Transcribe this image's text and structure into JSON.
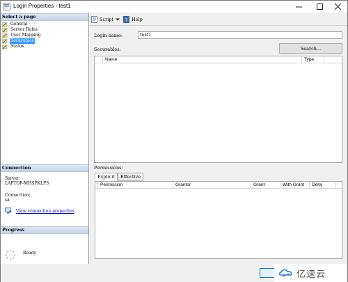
{
  "window": {
    "title": "Login Properties - test1"
  },
  "sidebar": {
    "select_page_header": "Select a page",
    "items": [
      {
        "label": "General",
        "selected": false
      },
      {
        "label": "Server Roles",
        "selected": false
      },
      {
        "label": "User Mapping",
        "selected": false
      },
      {
        "label": "Securables",
        "selected": true
      },
      {
        "label": "Status",
        "selected": false
      }
    ],
    "connection_header": "Connection",
    "server_label": "Server:",
    "server_value": "LAPTOP-MHSPKLFS",
    "connection_label": "Connection:",
    "connection_value": "sa",
    "view_connection_link": "View connection properties",
    "progress_header": "Progress",
    "progress_status": "Ready"
  },
  "toolbar": {
    "script_label": "Script",
    "help_label": "Help"
  },
  "form": {
    "login_name_label": "Login name:",
    "login_name_value": "test1",
    "securables_label": "Securables:",
    "search_button": "Search...",
    "securables_columns": [
      "Name",
      "Type"
    ],
    "permissions_label": "Permissions:",
    "tabs": [
      {
        "label": "Explicit",
        "active": true
      },
      {
        "label": "Effective",
        "active": false
      }
    ],
    "permissions_columns": [
      "Permission",
      "Grantor",
      "Grant",
      "With Grant",
      "Deny"
    ]
  },
  "watermark": {
    "text": "亿速云"
  },
  "colors": {
    "selection": "#3399ff",
    "header_gradient": "#c6d4e7",
    "link": "#0000cc"
  }
}
